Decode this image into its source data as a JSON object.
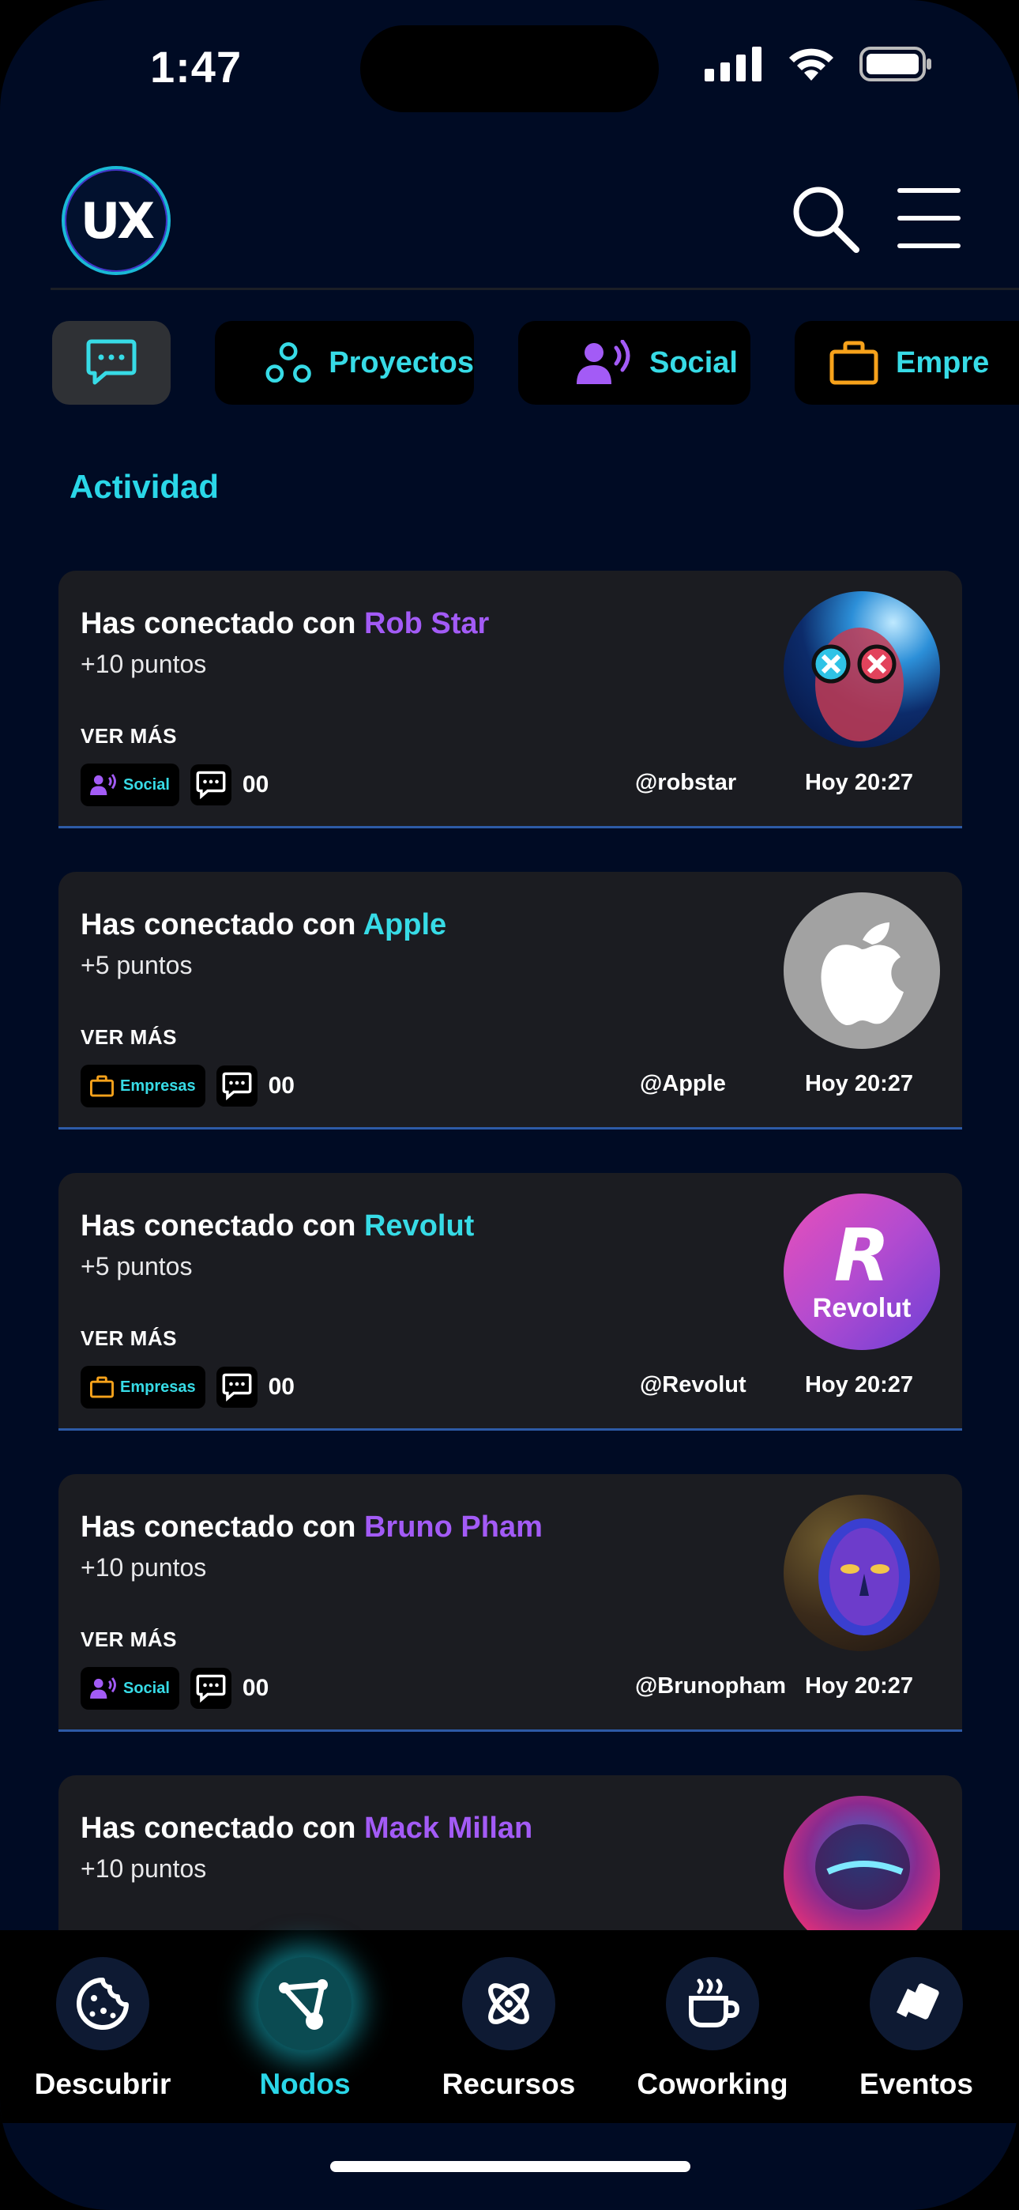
{
  "status_bar": {
    "time": "1:47"
  },
  "header": {
    "logo_text": "UX"
  },
  "tabs": [
    {
      "label": "Proyectos"
    },
    {
      "label": "Social"
    },
    {
      "label": "Empre"
    }
  ],
  "section_title": "Actividad",
  "cards": [
    {
      "prefix": "Has conectado con",
      "name": "Rob Star",
      "points": "+10 puntos",
      "more": "VER MÁS",
      "tag": "Social",
      "count": "00",
      "handle": "@robstar",
      "date": "Hoy 20:27"
    },
    {
      "prefix": "Has conectado con",
      "name": "Apple",
      "points": "+5 puntos",
      "more": "VER MÁS",
      "tag": "Empresas",
      "count": "00",
      "handle": "@Apple",
      "date": "Hoy 20:27"
    },
    {
      "prefix": "Has conectado con",
      "name": "Revolut",
      "points": "+5 puntos",
      "more": "VER MÁS",
      "tag": "Empresas",
      "count": "00",
      "handle": "@Revolut",
      "date": "Hoy 20:27",
      "logo_letter": "R",
      "logo_word": "Revolut"
    },
    {
      "prefix": "Has conectado con",
      "name": "Bruno Pham",
      "points": "+10 puntos",
      "more": "VER MÁS",
      "tag": "Social",
      "count": "00",
      "handle": "@Brunopham",
      "date": "Hoy 20:27"
    },
    {
      "prefix": "Has conectado con",
      "name": "Mack Millan",
      "points": "+10 puntos"
    }
  ],
  "bottom_nav": [
    {
      "label": "Descubrir",
      "icon": "cookie-icon"
    },
    {
      "label": "Nodos",
      "icon": "nodes-icon",
      "active": true
    },
    {
      "label": "Recursos",
      "icon": "atom-icon"
    },
    {
      "label": "Coworking",
      "icon": "coffee-icon"
    },
    {
      "label": "Eventos",
      "icon": "ticket-icon"
    }
  ],
  "colors": {
    "accent_cyan": "#37dbe6",
    "accent_purple": "#a35bf6",
    "accent_orange": "#f7a21b",
    "background": "#000b24"
  }
}
